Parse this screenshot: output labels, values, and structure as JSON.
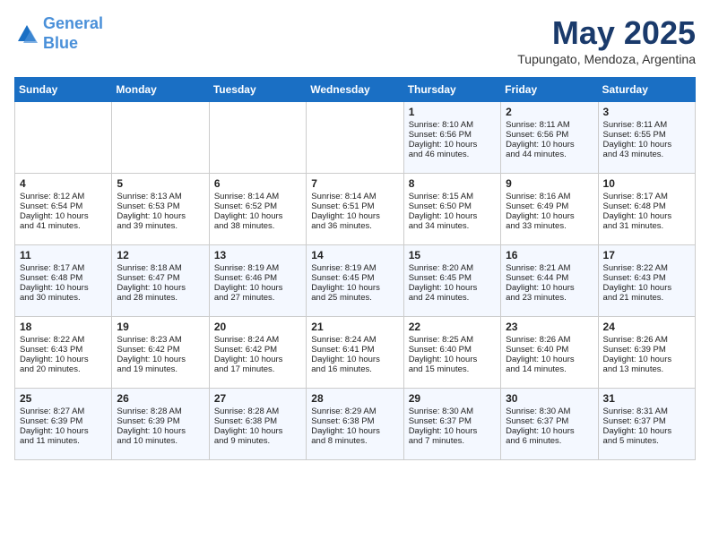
{
  "header": {
    "logo_line1": "General",
    "logo_line2": "Blue",
    "month": "May 2025",
    "location": "Tupungato, Mendoza, Argentina"
  },
  "weekdays": [
    "Sunday",
    "Monday",
    "Tuesday",
    "Wednesday",
    "Thursday",
    "Friday",
    "Saturday"
  ],
  "weeks": [
    [
      {
        "day": "",
        "info": ""
      },
      {
        "day": "",
        "info": ""
      },
      {
        "day": "",
        "info": ""
      },
      {
        "day": "",
        "info": ""
      },
      {
        "day": "1",
        "info": "Sunrise: 8:10 AM\nSunset: 6:56 PM\nDaylight: 10 hours\nand 46 minutes."
      },
      {
        "day": "2",
        "info": "Sunrise: 8:11 AM\nSunset: 6:56 PM\nDaylight: 10 hours\nand 44 minutes."
      },
      {
        "day": "3",
        "info": "Sunrise: 8:11 AM\nSunset: 6:55 PM\nDaylight: 10 hours\nand 43 minutes."
      }
    ],
    [
      {
        "day": "4",
        "info": "Sunrise: 8:12 AM\nSunset: 6:54 PM\nDaylight: 10 hours\nand 41 minutes."
      },
      {
        "day": "5",
        "info": "Sunrise: 8:13 AM\nSunset: 6:53 PM\nDaylight: 10 hours\nand 39 minutes."
      },
      {
        "day": "6",
        "info": "Sunrise: 8:14 AM\nSunset: 6:52 PM\nDaylight: 10 hours\nand 38 minutes."
      },
      {
        "day": "7",
        "info": "Sunrise: 8:14 AM\nSunset: 6:51 PM\nDaylight: 10 hours\nand 36 minutes."
      },
      {
        "day": "8",
        "info": "Sunrise: 8:15 AM\nSunset: 6:50 PM\nDaylight: 10 hours\nand 34 minutes."
      },
      {
        "day": "9",
        "info": "Sunrise: 8:16 AM\nSunset: 6:49 PM\nDaylight: 10 hours\nand 33 minutes."
      },
      {
        "day": "10",
        "info": "Sunrise: 8:17 AM\nSunset: 6:48 PM\nDaylight: 10 hours\nand 31 minutes."
      }
    ],
    [
      {
        "day": "11",
        "info": "Sunrise: 8:17 AM\nSunset: 6:48 PM\nDaylight: 10 hours\nand 30 minutes."
      },
      {
        "day": "12",
        "info": "Sunrise: 8:18 AM\nSunset: 6:47 PM\nDaylight: 10 hours\nand 28 minutes."
      },
      {
        "day": "13",
        "info": "Sunrise: 8:19 AM\nSunset: 6:46 PM\nDaylight: 10 hours\nand 27 minutes."
      },
      {
        "day": "14",
        "info": "Sunrise: 8:19 AM\nSunset: 6:45 PM\nDaylight: 10 hours\nand 25 minutes."
      },
      {
        "day": "15",
        "info": "Sunrise: 8:20 AM\nSunset: 6:45 PM\nDaylight: 10 hours\nand 24 minutes."
      },
      {
        "day": "16",
        "info": "Sunrise: 8:21 AM\nSunset: 6:44 PM\nDaylight: 10 hours\nand 23 minutes."
      },
      {
        "day": "17",
        "info": "Sunrise: 8:22 AM\nSunset: 6:43 PM\nDaylight: 10 hours\nand 21 minutes."
      }
    ],
    [
      {
        "day": "18",
        "info": "Sunrise: 8:22 AM\nSunset: 6:43 PM\nDaylight: 10 hours\nand 20 minutes."
      },
      {
        "day": "19",
        "info": "Sunrise: 8:23 AM\nSunset: 6:42 PM\nDaylight: 10 hours\nand 19 minutes."
      },
      {
        "day": "20",
        "info": "Sunrise: 8:24 AM\nSunset: 6:42 PM\nDaylight: 10 hours\nand 17 minutes."
      },
      {
        "day": "21",
        "info": "Sunrise: 8:24 AM\nSunset: 6:41 PM\nDaylight: 10 hours\nand 16 minutes."
      },
      {
        "day": "22",
        "info": "Sunrise: 8:25 AM\nSunset: 6:40 PM\nDaylight: 10 hours\nand 15 minutes."
      },
      {
        "day": "23",
        "info": "Sunrise: 8:26 AM\nSunset: 6:40 PM\nDaylight: 10 hours\nand 14 minutes."
      },
      {
        "day": "24",
        "info": "Sunrise: 8:26 AM\nSunset: 6:39 PM\nDaylight: 10 hours\nand 13 minutes."
      }
    ],
    [
      {
        "day": "25",
        "info": "Sunrise: 8:27 AM\nSunset: 6:39 PM\nDaylight: 10 hours\nand 11 minutes."
      },
      {
        "day": "26",
        "info": "Sunrise: 8:28 AM\nSunset: 6:39 PM\nDaylight: 10 hours\nand 10 minutes."
      },
      {
        "day": "27",
        "info": "Sunrise: 8:28 AM\nSunset: 6:38 PM\nDaylight: 10 hours\nand 9 minutes."
      },
      {
        "day": "28",
        "info": "Sunrise: 8:29 AM\nSunset: 6:38 PM\nDaylight: 10 hours\nand 8 minutes."
      },
      {
        "day": "29",
        "info": "Sunrise: 8:30 AM\nSunset: 6:37 PM\nDaylight: 10 hours\nand 7 minutes."
      },
      {
        "day": "30",
        "info": "Sunrise: 8:30 AM\nSunset: 6:37 PM\nDaylight: 10 hours\nand 6 minutes."
      },
      {
        "day": "31",
        "info": "Sunrise: 8:31 AM\nSunset: 6:37 PM\nDaylight: 10 hours\nand 5 minutes."
      }
    ]
  ]
}
